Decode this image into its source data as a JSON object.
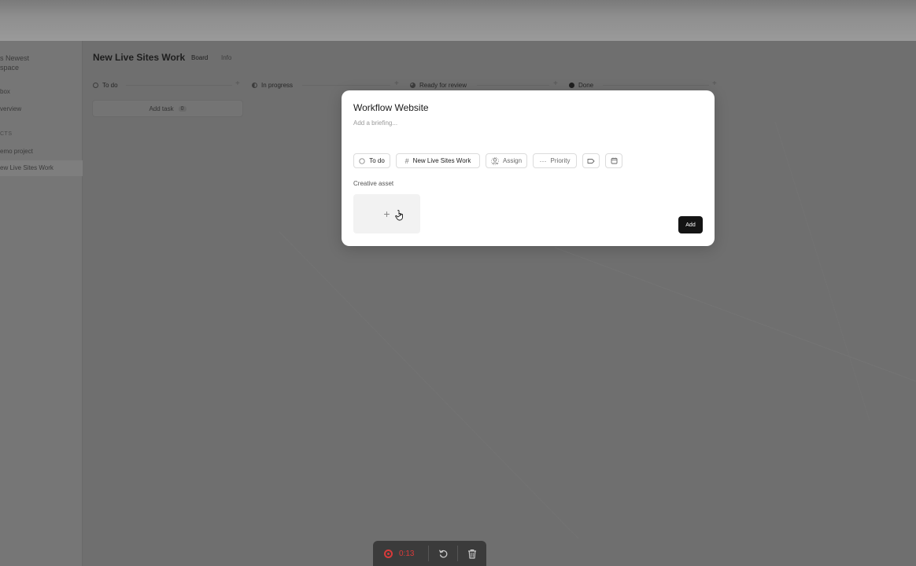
{
  "sidebar": {
    "workspace_name": "s Newest\nspace",
    "items": [
      {
        "label": "box"
      },
      {
        "label": "verview"
      },
      {
        "label": "CTS"
      },
      {
        "label": "emo project"
      },
      {
        "label": "ew Live Sites Work"
      }
    ]
  },
  "header": {
    "title": "New Live Sites Work",
    "tabs": [
      {
        "label": "Board"
      },
      {
        "label": "Info"
      }
    ]
  },
  "board": {
    "columns": [
      {
        "label": "To do"
      },
      {
        "label": "In progress"
      },
      {
        "label": "Ready for review"
      },
      {
        "label": "Done"
      }
    ],
    "add_task": {
      "label": "Add task",
      "count": "0"
    },
    "plus": "+"
  },
  "modal": {
    "title": "Workflow Website",
    "briefing_placeholder": "Add a briefing...",
    "chips": {
      "status": "To do",
      "project_hash": "#",
      "project": "New Live Sites Work",
      "assign": "Assign",
      "priority_dots": "···",
      "priority": "Priority"
    },
    "creative_asset_label": "Creative asset",
    "upload_plus": "+",
    "add_button": "Add"
  },
  "recorder": {
    "timer": "0:13"
  },
  "colors": {
    "overlay_gray": "#6f6f6f",
    "modal_bg": "#ffffff",
    "primary_button": "#141414",
    "record_red": "#d93a3a"
  }
}
